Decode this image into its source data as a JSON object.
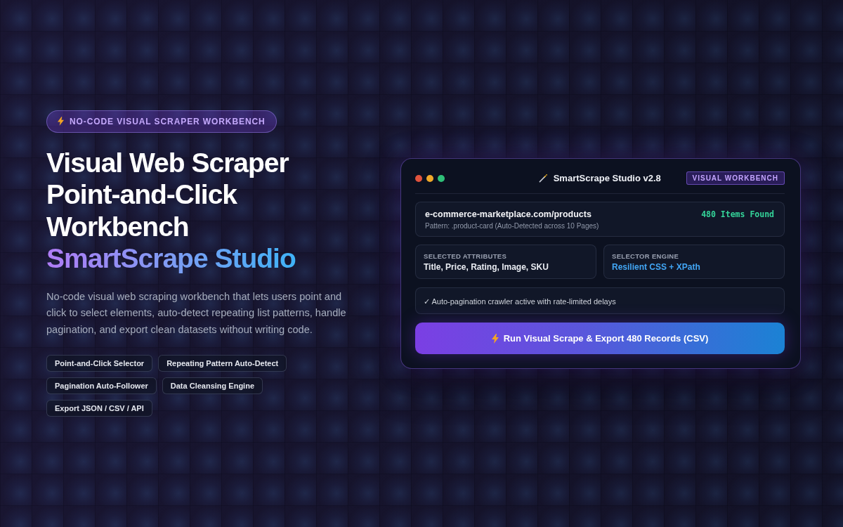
{
  "hero": {
    "badge": "NO-CODE VISUAL SCRAPER WORKBENCH",
    "title_lines": [
      "Visual Web Scraper",
      "Point-and-Click",
      "Workbench"
    ],
    "title_highlight": "SmartScrape Studio",
    "description": "No-code visual web scraping workbench that lets users point and click to select elements, auto-detect repeating list patterns, handle pagination, and export clean datasets without writing code.",
    "tags": [
      "Point-and-Click Selector",
      "Repeating Pattern Auto-Detect",
      "Pagination Auto-Follower",
      "Data Cleansing Engine",
      "Export JSON / CSV / API"
    ]
  },
  "window": {
    "title": "SmartScrape Studio v2.8",
    "badge": "VISUAL WORKBENCH",
    "source": {
      "url": "e-commerce-marketplace.com/products",
      "pattern": "Pattern: .product-card (Auto-Detected across 10 Pages)",
      "count": "480 Items Found"
    },
    "fields": [
      {
        "kind": "plain",
        "label": "SELECTED ATTRIBUTES",
        "value": "Title, Price, Rating, Image, SKU"
      },
      {
        "kind": "accent",
        "label": "SELECTOR ENGINE",
        "value": "Resilient CSS + XPath"
      }
    ],
    "status": "✓ Auto-pagination crawler active with rate-limited delays",
    "action_button": "Run Visual Scrape & Export 480 Records (CSV)"
  }
}
